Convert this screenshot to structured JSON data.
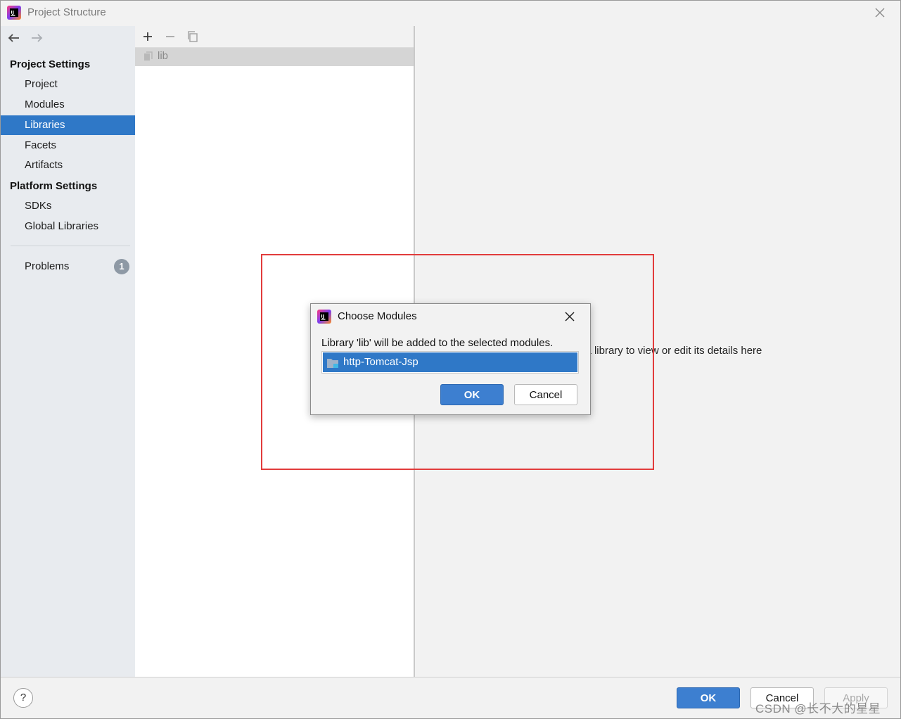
{
  "window": {
    "title": "Project Structure",
    "icons": {
      "logo": "intellij-logo-icon",
      "close": "close-icon"
    }
  },
  "sidebar": {
    "nav": {
      "back": "arrow-left-icon",
      "forward": "arrow-right-icon"
    },
    "project_settings_header": "Project Settings",
    "project_items": [
      {
        "label": "Project",
        "selected": false
      },
      {
        "label": "Modules",
        "selected": false
      },
      {
        "label": "Libraries",
        "selected": true
      },
      {
        "label": "Facets",
        "selected": false
      },
      {
        "label": "Artifacts",
        "selected": false
      }
    ],
    "platform_settings_header": "Platform Settings",
    "platform_items": [
      {
        "label": "SDKs"
      },
      {
        "label": "Global Libraries"
      }
    ],
    "problems": {
      "label": "Problems",
      "count": "1"
    }
  },
  "library_panel": {
    "toolbar": {
      "add": "plus-icon",
      "remove": "minus-icon",
      "copy": "copy-icon"
    },
    "libraries": [
      {
        "name": "lib",
        "icon": "library-icon"
      }
    ]
  },
  "details": {
    "hint": "Select a library to view or edit its details here"
  },
  "dialog": {
    "title": "Choose Modules",
    "message": "Library 'lib' will be added to the selected modules.",
    "modules": [
      {
        "name": "http-Tomcat-Jsp",
        "icon": "module-folder-icon",
        "selected": true
      }
    ],
    "ok_label": "OK",
    "cancel_label": "Cancel"
  },
  "bottom_bar": {
    "help_label": "?",
    "ok_label": "OK",
    "cancel_label": "Cancel",
    "apply_label": "Apply",
    "watermark": "CSDN @长不大的星星"
  },
  "colors": {
    "accent": "#2f78c7",
    "annotation": "#e23c3c",
    "badge": "#8e99a5"
  }
}
